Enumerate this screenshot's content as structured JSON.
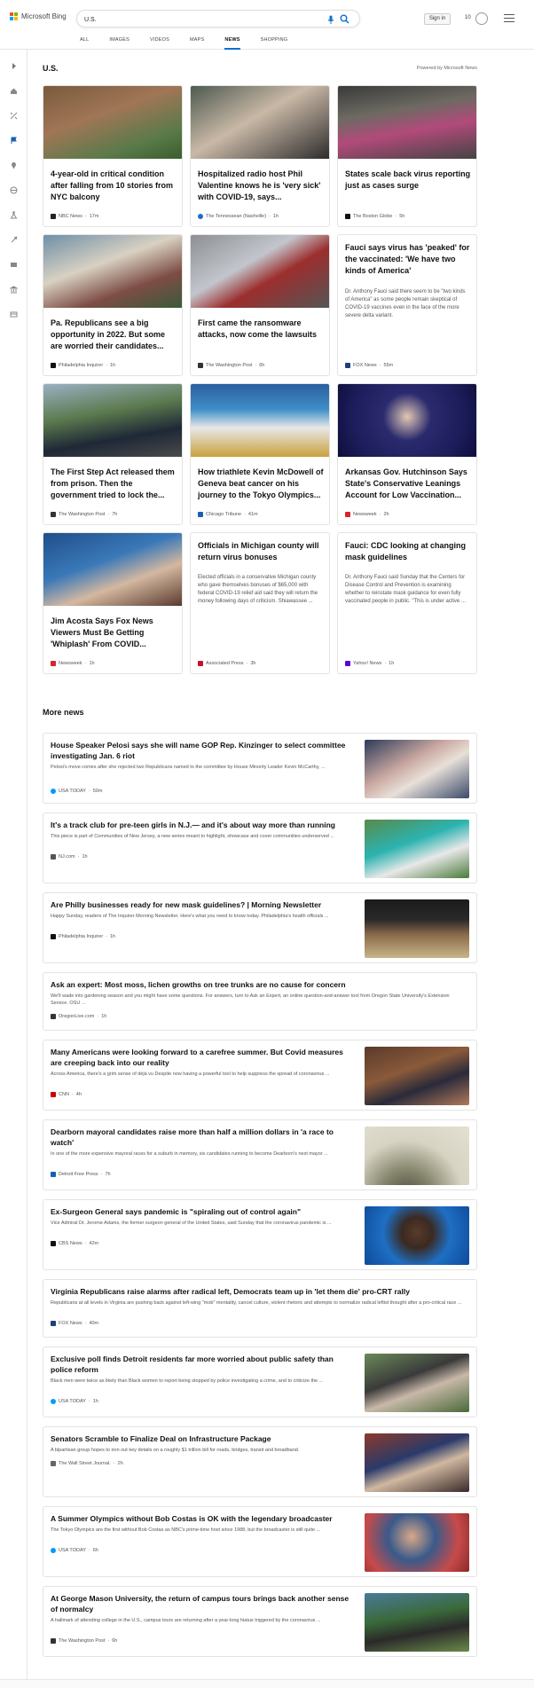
{
  "header": {
    "logo": "Microsoft Bing",
    "search_value": "U.S.",
    "signin": "Sign in",
    "points": "10"
  },
  "tabs": [
    "ALL",
    "IMAGES",
    "VIDEOS",
    "MAPS",
    "NEWS",
    "SHOPPING"
  ],
  "section": {
    "title": "U.S.",
    "powered": "Powered by Microsoft News"
  },
  "cards": [
    {
      "title": "4-year-old in critical condition after falling from 10 stories from NYC balcony",
      "source": "NBC News",
      "time": "17m",
      "desc": ""
    },
    {
      "title": "Hospitalized radio host Phil Valentine knows he is 'very sick' with COVID-19, says...",
      "source": "The Tennessean (Nashville)",
      "time": "1h",
      "desc": ""
    },
    {
      "title": "States scale back virus reporting just as cases surge",
      "source": "The Boston Globe",
      "time": "5h",
      "desc": ""
    },
    {
      "title": "Pa. Republicans see a big opportunity in 2022. But some are worried their candidates...",
      "source": "Philadelphia Inquirer",
      "time": "1h",
      "desc": ""
    },
    {
      "title": "First came the ransomware attacks, now come the lawsuits",
      "source": "The Washington Post",
      "time": "6h",
      "desc": ""
    },
    {
      "title": "Fauci says virus has 'peaked' for the vaccinated: 'We have two kinds of America'",
      "source": "FOX News",
      "time": "55m",
      "desc": "Dr. Anthony Fauci said there seem to be \"two kinds of America\" as some people remain skeptical of COVID-19 vaccines even in the face of the more severe delta variant."
    },
    {
      "title": "The First Step Act released them from prison. Then the government tried to lock the...",
      "source": "The Washington Post",
      "time": "7h",
      "desc": ""
    },
    {
      "title": "How triathlete Kevin McDowell of Geneva beat cancer on his journey to the Tokyo Olympics...",
      "source": "Chicago Tribune",
      "time": "41m",
      "desc": ""
    },
    {
      "title": "Arkansas Gov. Hutchinson Says State's Conservative Leanings Account for Low Vaccination...",
      "source": "Newsweek",
      "time": "2h",
      "desc": ""
    },
    {
      "title": "Jim Acosta Says Fox News Viewers Must Be Getting 'Whiplash' From COVID...",
      "source": "Newsweek",
      "time": "1h",
      "desc": ""
    },
    {
      "title": "Officials in Michigan county will return virus bonuses",
      "source": "Associated Press",
      "time": "3h",
      "desc": "Elected officials in a conservative Michigan county who gave themselves bonuses of $65,000 with federal COVID-19 relief aid said they will return the money following days of criticism. Shiawassee ..."
    },
    {
      "title": "Fauci: CDC looking at changing mask guidelines",
      "source": "Yahoo! News",
      "time": "1h",
      "desc": "Dr. Anthony Fauci said Sunday that the Centers for Disease Control and Prevention is examining whether to reinstate mask guidance for even fully vaccinated people in public. \"This is under active ..."
    }
  ],
  "more_title": "More news",
  "rows": [
    {
      "title": "House Speaker Pelosi says she will name GOP Rep. Kinzinger to select committee investigating Jan. 6 riot",
      "desc": "Pelosi's move comes after she rejected two Republicans named to the committee by House Minority Leader Kevin McCarthy, ...",
      "source": "USA TODAY",
      "time": "50m"
    },
    {
      "title": "It's a track club for pre-teen girls in N.J.— and it's about way more than running",
      "desc": "This piece is part of Communities of New Jersey, a new series meant to highlight, showcase and cover communities underserved ...",
      "source": "NJ.com",
      "time": "1h"
    },
    {
      "title": "Are Philly businesses ready for new mask guidelines? | Morning Newsletter",
      "desc": "Happy Sunday, readers of The Inquirer Morning Newsletter. Here's what you need to know today. Philadelphia's health officials ...",
      "source": "Philadelphia Inquirer",
      "time": "1h"
    },
    {
      "title": "Ask an expert: Most moss, lichen growths on tree trunks are no cause for concern",
      "desc": "We'll wade into gardening season and you might have some questions. For answers, turn to Ask an Expert, an online question-and-answer tool from Oregon State University's Extension Service. OSU ...",
      "source": "OregonLive.com",
      "time": "1h"
    },
    {
      "title": "Many Americans were looking forward to a carefree summer. But Covid measures are creeping back into our reality",
      "desc": "Across America, there's a grim sense of déjà vu Despite now having a powerful tool to help suppress the spread of coronavirus ...",
      "source": "CNN",
      "time": "4h"
    },
    {
      "title": "Dearborn mayoral candidates raise more than half a million dollars in 'a race to watch'",
      "desc": "In one of the more expensive mayoral races for a suburb in memory, six candidates running to become Dearborn's next mayor ...",
      "source": "Detroit Free Press",
      "time": "7h"
    },
    {
      "title": "Ex-Surgeon General says pandemic is \"spiraling out of control again\"",
      "desc": "Vice Admiral Dr. Jerome Adams, the former surgeon general of the United States, said Sunday that the coronavirus pandemic is ...",
      "source": "CBS News",
      "time": "42m"
    },
    {
      "title": "Virginia Republicans raise alarms after radical left, Democrats team up in 'let them die' pro-CRT rally",
      "desc": "Republicans at all levels in Virginia are pushing back against left-wing \"mob\" mentality, cancel culture, violent rhetoric and attempts to normalize radical leftist thought after a pro-critical race ...",
      "source": "FOX News",
      "time": "40m"
    },
    {
      "title": "Exclusive poll finds Detroit residents far more worried about public safety than police reform",
      "desc": "Black men were twice as likely than Black women to report being stopped by police investigating a crime, and to criticize the ...",
      "source": "USA TODAY",
      "time": "1h"
    },
    {
      "title": "Senators Scramble to Finalize Deal on Infrastructure Package",
      "desc": "A bipartisan group hopes to iron out key details on a roughly $1 trillion bill for roads, bridges, transit and broadband.",
      "source": "The Wall Street Journal.",
      "time": "2h"
    },
    {
      "title": "A Summer Olympics without Bob Costas is OK with the legendary broadcaster",
      "desc": "The Tokyo Olympics are the first without Bob Costas as NBC's prime-time host since 1988, but the broadcaster is still quite ...",
      "source": "USA TODAY",
      "time": "6h"
    },
    {
      "title": "At George Mason University, the return of campus tours brings back another sense of normalcy",
      "desc": "A hallmark of attending college in the U.S., campus tours are returning after a year-long hiatus triggered by the coronavirus ...",
      "source": "The Washington Post",
      "time": "6h"
    }
  ]
}
